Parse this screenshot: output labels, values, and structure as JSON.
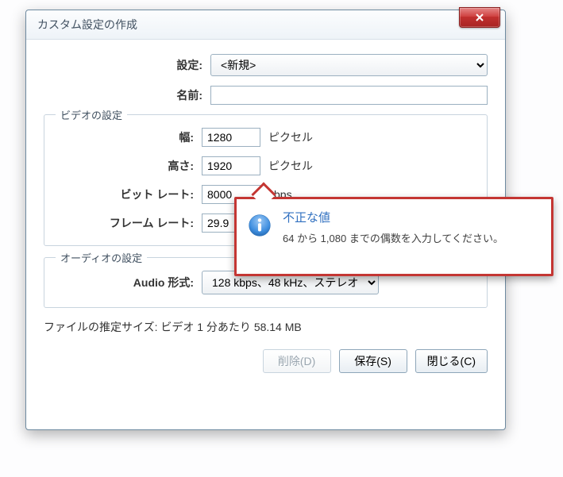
{
  "dialog": {
    "title": "カスタム設定の作成",
    "setting_label": "設定:",
    "setting_value": "<新規>",
    "name_label": "名前:",
    "name_value": ""
  },
  "video": {
    "legend": "ビデオの設定",
    "width_label": "幅:",
    "width_value": "1280",
    "width_unit": "ピクセル",
    "height_label": "高さ:",
    "height_value": "1920",
    "height_unit": "ピクセル",
    "bitrate_label": "ビット レート:",
    "bitrate_value": "8000",
    "bitrate_unit": "kbps",
    "framerate_label": "フレーム レート:",
    "framerate_value": "29.9",
    "framerate_unit": ""
  },
  "audio": {
    "legend": "オーディオの設定",
    "format_label": "Audio 形式:",
    "format_value": "128 kbps、48 kHz、ステレオ"
  },
  "estimate": {
    "text": "ファイルの推定サイズ: ビデオ 1 分あたり 58.14 MB"
  },
  "buttons": {
    "delete": "削除(D)",
    "save": "保存(S)",
    "close": "閉じる(C)"
  },
  "error": {
    "title": "不正な値",
    "message": "64 から 1,080 までの偶数を入力してください。"
  }
}
